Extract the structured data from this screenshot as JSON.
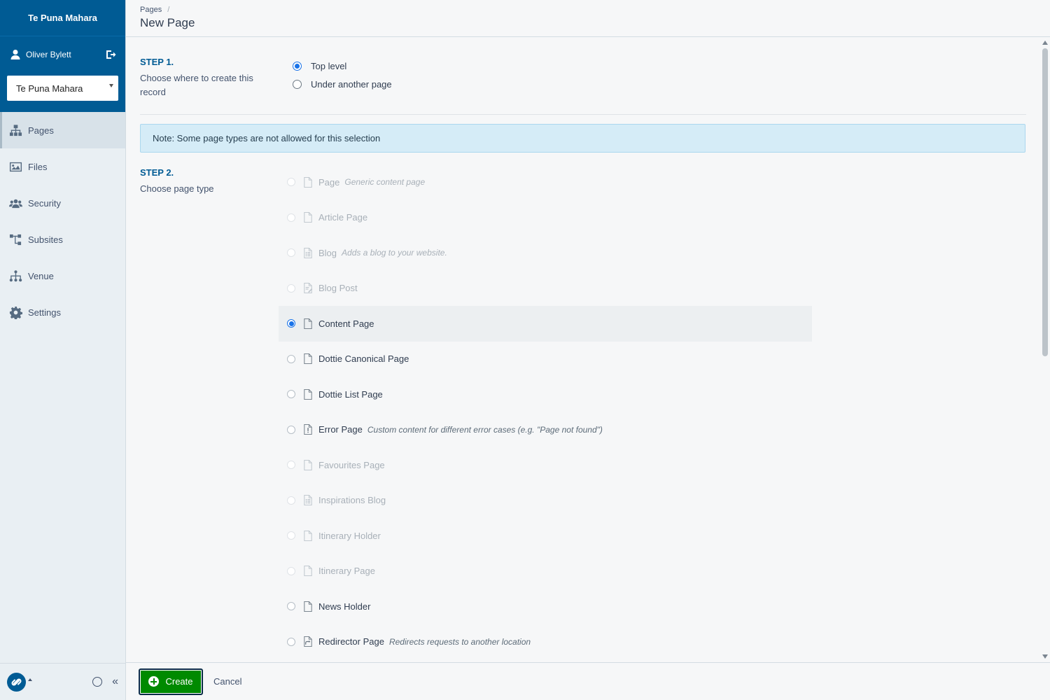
{
  "sidebar": {
    "brand": "Te Puna Mahara",
    "user_name": "Oliver Bylett",
    "subsite_selected": "Te Puna Mahara",
    "items": [
      {
        "label": "Pages",
        "icon": "sitemap-icon"
      },
      {
        "label": "Files",
        "icon": "image-icon"
      },
      {
        "label": "Security",
        "icon": "users-icon"
      },
      {
        "label": "Subsites",
        "icon": "subsites-icon"
      },
      {
        "label": "Venue",
        "icon": "venue-tree-icon"
      },
      {
        "label": "Settings",
        "icon": "gear-icon"
      }
    ]
  },
  "header": {
    "breadcrumb": "Pages",
    "breadcrumb_sep": "/",
    "title": "New Page"
  },
  "step1": {
    "title": "STEP 1.",
    "desc": "Choose where to create this record",
    "options": [
      "Top level",
      "Under another page"
    ],
    "selected": "Top level"
  },
  "alert": "Note: Some page types are not allowed for this selection",
  "step2": {
    "title": "STEP 2.",
    "desc": "Choose page type",
    "types": [
      {
        "label": "Page",
        "desc": "Generic content page",
        "disabled": true,
        "icon": "page-icon"
      },
      {
        "label": "Article Page",
        "desc": "",
        "disabled": true,
        "icon": "page-icon"
      },
      {
        "label": "Blog",
        "desc": "Adds a blog to your website.",
        "disabled": true,
        "icon": "blog-icon"
      },
      {
        "label": "Blog Post",
        "desc": "",
        "disabled": true,
        "icon": "blog-post-icon"
      },
      {
        "label": "Content Page",
        "desc": "",
        "disabled": false,
        "icon": "page-icon",
        "selected": true
      },
      {
        "label": "Dottie Canonical Page",
        "desc": "",
        "disabled": false,
        "icon": "page-icon"
      },
      {
        "label": "Dottie List Page",
        "desc": "",
        "disabled": false,
        "icon": "page-icon"
      },
      {
        "label": "Error Page",
        "desc": "Custom content for different error cases (e.g. \"Page not found\")",
        "disabled": false,
        "icon": "error-page-icon"
      },
      {
        "label": "Favourites Page",
        "desc": "",
        "disabled": true,
        "icon": "page-icon"
      },
      {
        "label": "Inspirations Blog",
        "desc": "",
        "disabled": true,
        "icon": "blog-icon"
      },
      {
        "label": "Itinerary Holder",
        "desc": "",
        "disabled": true,
        "icon": "page-icon"
      },
      {
        "label": "Itinerary Page",
        "desc": "",
        "disabled": true,
        "icon": "page-icon"
      },
      {
        "label": "News Holder",
        "desc": "",
        "disabled": false,
        "icon": "page-icon"
      },
      {
        "label": "Redirector Page",
        "desc": "Redirects requests to another location",
        "disabled": false,
        "icon": "redirect-page-icon"
      }
    ]
  },
  "footer": {
    "create_label": "Create",
    "cancel_label": "Cancel"
  },
  "colors": {
    "brand_blue": "#005b94",
    "create_green": "#008a00",
    "radio_blue": "#1a73e8"
  }
}
